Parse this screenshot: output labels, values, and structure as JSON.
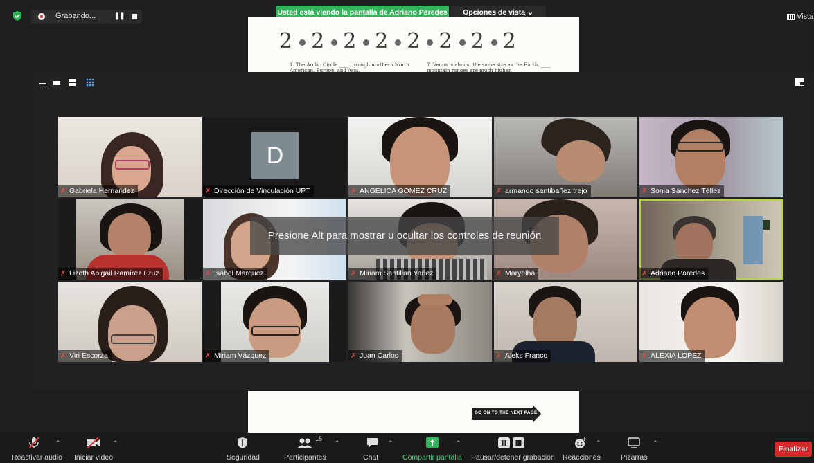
{
  "topbar": {
    "recording_label": "Grabando...",
    "share_banner": "Usted está viendo la pantalla de Adriano Paredes",
    "view_options": "Opciones de vista",
    "view_button": "Vista"
  },
  "document": {
    "numbers": [
      "2",
      "2",
      "2",
      "2",
      "2",
      "2",
      "2",
      "2"
    ],
    "question1": "1. The Arctic Circle ____ through northern North American, Europe, and Asia.",
    "question7": "7. Venus is almost the same size as the Earth, ____ mountain ranges are much higher.",
    "next_page": "GO ON TO THE NEXT PAGE"
  },
  "participants": [
    {
      "name": "Gabriela Hernandez"
    },
    {
      "name": "Dirección de Vinculación UPT",
      "avatar_letter": "D"
    },
    {
      "name": "ANGELICA GOMEZ CRUZ"
    },
    {
      "name": "armando santibañez trejo"
    },
    {
      "name": "Sonia Sánchez Téllez"
    },
    {
      "name": "Lizeth Abigail Ramírez Cruz"
    },
    {
      "name": "Isabel Marquez"
    },
    {
      "name": "Miriam Santillan Yañez"
    },
    {
      "name": "Maryelha"
    },
    {
      "name": "Adriano Paredes",
      "active_speaker": true
    },
    {
      "name": "Viri Escorza"
    },
    {
      "name": "Miriam Vázquez"
    },
    {
      "name": "Juan Carlos"
    },
    {
      "name": "Aleks Franco"
    },
    {
      "name": "ALEXIA LÓPEZ"
    }
  ],
  "overlay_message": "Presione Alt para mostrar u ocultar los controles de reunión",
  "toolbar": {
    "audio": "Reactivar audio",
    "video": "Iniciar video",
    "security": "Seguridad",
    "participants": "Participantes",
    "participant_count": "15",
    "chat": "Chat",
    "share": "Compartir pantalla",
    "record": "Pausar/detener grabación",
    "reactions": "Reacciones",
    "whiteboards": "Pizarras",
    "end": "Finalizar"
  },
  "colors": {
    "share_green": "#32b45a",
    "end_red": "#d62a2a",
    "active_speaker": "#b8d44a",
    "muted_red": "#e74c3c"
  }
}
